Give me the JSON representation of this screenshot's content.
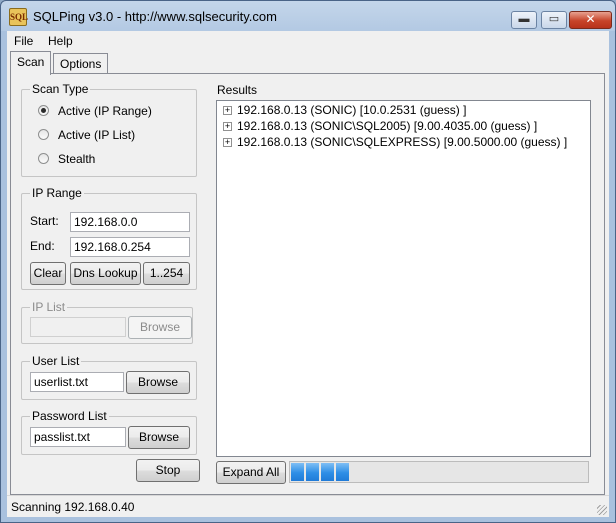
{
  "window": {
    "title": "SQLPing v3.0 - http://www.sqlsecurity.com",
    "icon_text": "SQL",
    "minimize_symbol": "▬",
    "maximize_symbol": "▭",
    "close_symbol": "✕"
  },
  "menu": {
    "items": [
      "File",
      "Help"
    ]
  },
  "tabs": [
    {
      "label": "Scan",
      "active": true
    },
    {
      "label": "Options",
      "active": false
    }
  ],
  "scan_type": {
    "title": "Scan Type",
    "options": [
      {
        "label": "Active (IP Range)",
        "checked": true
      },
      {
        "label": "Active (IP List)",
        "checked": false
      },
      {
        "label": "Stealth",
        "checked": false
      }
    ]
  },
  "ip_range": {
    "title": "IP Range",
    "start_label": "Start:",
    "start_value": "192.168.0.0",
    "end_label": "End:",
    "end_value": "192.168.0.254",
    "clear_label": "Clear",
    "dns_label": "Dns Lookup",
    "range_label": "1..254"
  },
  "ip_list": {
    "title": "IP List",
    "value": "",
    "browse_label": "Browse",
    "enabled": false
  },
  "user_list": {
    "title": "User List",
    "value": "userlist.txt",
    "browse_label": "Browse"
  },
  "password_list": {
    "title": "Password List",
    "value": "passlist.txt",
    "browse_label": "Browse"
  },
  "stop_label": "Stop",
  "results": {
    "title": "Results",
    "items": [
      "192.168.0.13 (SONIC)   [10.0.2531 (guess) ]",
      "192.168.0.13 (SONIC\\SQL2005)   [9.00.4035.00 (guess) ]",
      "192.168.0.13 (SONIC\\SQLEXPRESS)   [9.00.5000.00 (guess) ]"
    ],
    "expand_symbol": "+"
  },
  "expand_all_label": "Expand All",
  "progress": {
    "filled_segments": 4
  },
  "status": {
    "text": "Scanning 192.168.0.40"
  },
  "colors": {
    "titlebar": "#b3c9e3",
    "progress": "#2e8ee6",
    "close": "#c7442a"
  }
}
